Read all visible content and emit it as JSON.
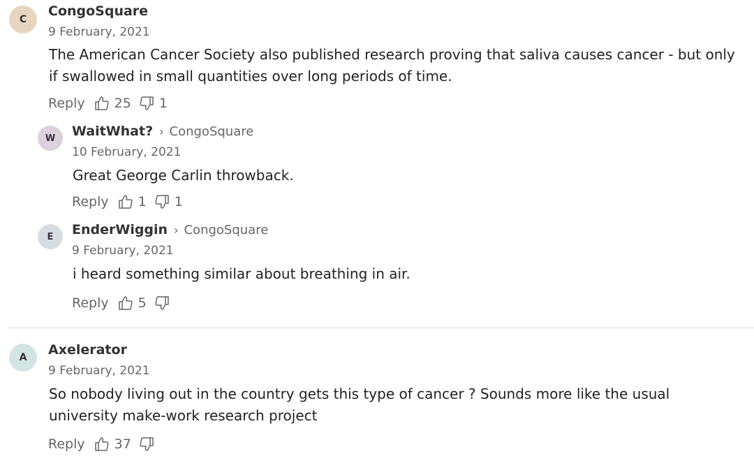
{
  "comments": [
    {
      "initial": "C",
      "author": "CongoSquare",
      "date": "9 February, 2021",
      "body": "The American Cancer Society also published research proving that saliva causes cancer - but only if swallowed in small quantities over long periods of time.",
      "reply_label": "Reply",
      "upvotes": "25",
      "downvotes": "1",
      "avatar_color": "#e8d5c0"
    },
    {
      "initial": "W",
      "author": "WaitWhat?",
      "reply_to": "CongoSquare",
      "date": "10 February, 2021",
      "body": "Great George Carlin throwback.",
      "reply_label": "Reply",
      "upvotes": "1",
      "downvotes": "1",
      "avatar_color": "#ddd0dd"
    },
    {
      "initial": "E",
      "author": "EnderWiggin",
      "reply_to": "CongoSquare",
      "date": "9 February, 2021",
      "body": "i heard something similar about breathing in air.",
      "reply_label": "Reply",
      "upvotes": "5",
      "downvotes": "",
      "avatar_color": "#d5dde2"
    },
    {
      "initial": "A",
      "author": "Axelerator",
      "date": "9 February, 2021",
      "body": "So nobody living out in the country gets this type of cancer ?  Sounds more like the usual university make-work research project",
      "reply_label": "Reply",
      "upvotes": "37",
      "downvotes": "",
      "avatar_color": "#d3e5e2"
    }
  ]
}
